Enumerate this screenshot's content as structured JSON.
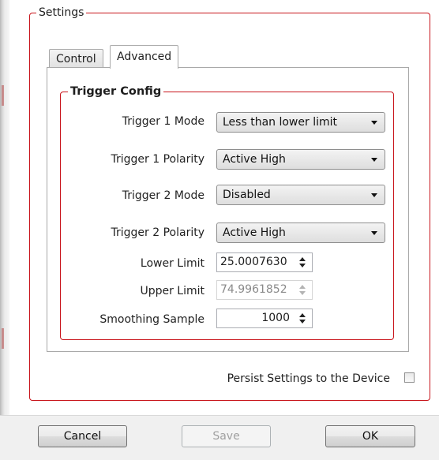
{
  "settings": {
    "group_title": "Settings",
    "tabs": [
      {
        "label": "Control"
      },
      {
        "label": "Advanced"
      }
    ],
    "active_tab": "Advanced"
  },
  "trigger_config": {
    "group_title": "Trigger Config",
    "trigger1_mode": {
      "label": "Trigger 1 Mode",
      "value": "Less than lower limit"
    },
    "trigger1_polarity": {
      "label": "Trigger 1 Polarity",
      "value": "Active High"
    },
    "trigger2_mode": {
      "label": "Trigger 2 Mode",
      "value": "Disabled"
    },
    "trigger2_polarity": {
      "label": "Trigger 2 Polarity",
      "value": "Active High"
    },
    "lower_limit": {
      "label": "Lower Limit",
      "value": "25.0007630"
    },
    "upper_limit": {
      "label": "Upper Limit",
      "value": "74.9961852",
      "disabled": true
    },
    "smoothing_sample": {
      "label": "Smoothing Sample",
      "value": "1000"
    }
  },
  "persist": {
    "label": "Persist Settings to the Device",
    "checked": false
  },
  "buttons": {
    "cancel": "Cancel",
    "save": "Save",
    "ok": "OK"
  },
  "colors": {
    "group_border": "#c8141b"
  }
}
